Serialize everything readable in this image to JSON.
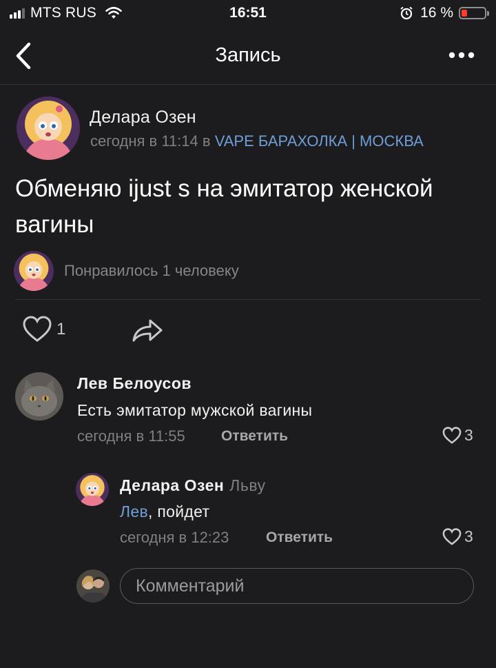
{
  "status_bar": {
    "carrier": "MTS RUS",
    "time": "16:51",
    "battery": "16 %"
  },
  "nav": {
    "title": "Запись"
  },
  "post": {
    "author": "Делара Озен",
    "time": "сегодня в 11:14",
    "in_word": "в",
    "community": "VAPE БАРАХОЛКА | МОСКВА",
    "text": "Обменяю ijust s на эмитатор женской вагины",
    "likes_text": "Понравилось 1 человеку",
    "like_count": "1"
  },
  "comments": [
    {
      "author": "Лев Белоусов",
      "text": "Есть эмитатор мужской вагины",
      "time": "сегодня в 11:55",
      "reply_label": "Ответить",
      "like_count": "3"
    },
    {
      "author": "Делара Озен",
      "reply_to": "Льву",
      "mention": "Лев",
      "text": ", пойдет",
      "time": "сегодня в 12:23",
      "reply_label": "Ответить",
      "like_count": "3"
    }
  ],
  "composer": {
    "placeholder": "Комментарий"
  },
  "colors": {
    "background": "#1c1c1e",
    "link": "#6f9ed6",
    "battery_low": "#ff3b30"
  },
  "icons": {
    "back": "chevron-left-icon",
    "more": "more-dots-icon",
    "like": "heart-icon",
    "share": "share-arrow-icon"
  }
}
